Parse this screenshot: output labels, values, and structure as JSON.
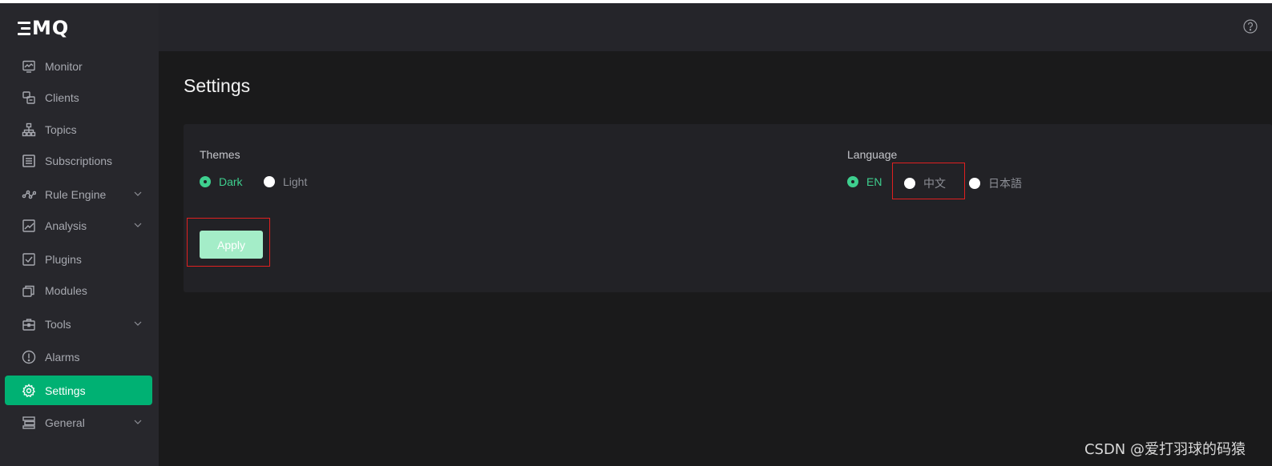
{
  "logo": {
    "text": "MQ"
  },
  "sidebar": {
    "items": [
      {
        "label": "Monitor",
        "icon": "monitor-icon",
        "expandable": false,
        "active": false
      },
      {
        "label": "Clients",
        "icon": "clients-icon",
        "expandable": false,
        "active": false
      },
      {
        "label": "Topics",
        "icon": "topics-icon",
        "expandable": false,
        "active": false
      },
      {
        "label": "Subscriptions",
        "icon": "subscriptions-icon",
        "expandable": false,
        "active": false
      },
      {
        "label": "Rule Engine",
        "icon": "rule-engine-icon",
        "expandable": true,
        "active": false
      },
      {
        "label": "Analysis",
        "icon": "analysis-icon",
        "expandable": true,
        "active": false
      },
      {
        "label": "Plugins",
        "icon": "plugins-icon",
        "expandable": false,
        "active": false
      },
      {
        "label": "Modules",
        "icon": "modules-icon",
        "expandable": false,
        "active": false
      },
      {
        "label": "Tools",
        "icon": "tools-icon",
        "expandable": true,
        "active": false
      },
      {
        "label": "Alarms",
        "icon": "alarms-icon",
        "expandable": false,
        "active": false
      },
      {
        "label": "Settings",
        "icon": "gear-icon",
        "expandable": false,
        "active": true
      },
      {
        "label": "General",
        "icon": "general-icon",
        "expandable": true,
        "active": false
      }
    ]
  },
  "header": {
    "help_icon": "help-icon"
  },
  "page": {
    "title": "Settings"
  },
  "settings": {
    "themes": {
      "label": "Themes",
      "options": [
        {
          "label": "Dark",
          "checked": true
        },
        {
          "label": "Light",
          "checked": false
        }
      ]
    },
    "language": {
      "label": "Language",
      "options": [
        {
          "label": "EN",
          "checked": true
        },
        {
          "label": "中文",
          "checked": false
        },
        {
          "label": "日本語",
          "checked": false
        }
      ]
    },
    "apply_label": "Apply"
  },
  "watermark": "CSDN @爱打羽球的码猿",
  "colors": {
    "accent": "#00b173",
    "checked": "#3ecf8e",
    "apply_bg": "#a4edc8",
    "highlight": "#e02020",
    "sidebar_bg": "#27272c",
    "content_bg": "#1a1a1b"
  }
}
